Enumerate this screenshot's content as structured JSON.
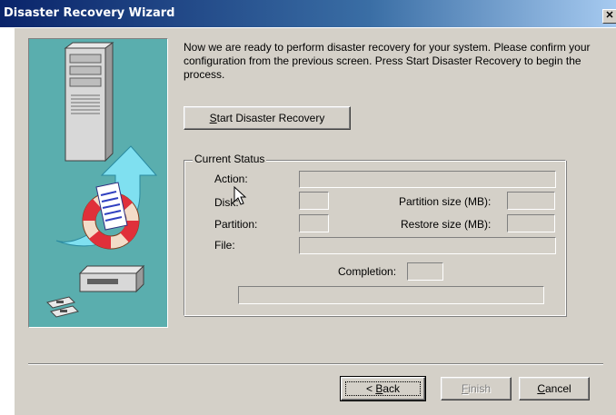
{
  "window": {
    "title": "Disaster Recovery Wizard",
    "close_glyph": "✕"
  },
  "illustration": {
    "icon": "server-to-restore-illustration",
    "background_color": "#5aaeae"
  },
  "intro_text": "Now we are ready to perform disaster recovery for your system. Please confirm your configuration from the previous screen. Press Start Disaster Recovery to begin the process.",
  "start_button": {
    "mnemonic": "S",
    "rest": "tart Disaster Recovery"
  },
  "status": {
    "group_label": "Current Status",
    "action_label": "Action:",
    "disk_label": "Disk:",
    "partition_label": "Partition:",
    "file_label": "File:",
    "partition_size_label": "Partition size (MB):",
    "restore_size_label": "Restore size (MB):",
    "completion_label": "Completion:",
    "progress": 0
  },
  "footer": {
    "back": {
      "prefix": "< ",
      "mnemonic": "B",
      "rest": "ack"
    },
    "finish": {
      "mnemonic": "F",
      "rest": "inish"
    },
    "cancel": {
      "mnemonic": "C",
      "rest": "ancel"
    }
  }
}
